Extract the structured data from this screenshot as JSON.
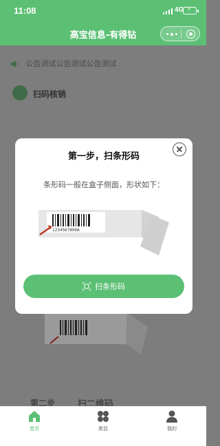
{
  "status_bar": {
    "time": "11:08",
    "network": "4G"
  },
  "nav": {
    "title": "高宝信息-有得钻"
  },
  "background": {
    "notice_text": "公告测试公告测试公告测试",
    "scan_title": "扫码核销",
    "step2_label": "第二步",
    "step2_text": "扫二维码"
  },
  "modal": {
    "title": "第一步，扫条形码",
    "description": "条形码一般在盒子侧面，形状如下：",
    "barcode_number": "1234567890A",
    "button_label": "扫条形码"
  },
  "tabbar": {
    "items": [
      {
        "label": "首页",
        "icon": "home-icon",
        "active": true
      },
      {
        "label": "类目",
        "icon": "category-icon",
        "active": false
      },
      {
        "label": "我的",
        "icon": "user-icon",
        "active": false
      }
    ]
  },
  "colors": {
    "brand": "#5bbf74",
    "overlay": "#7d7d7d",
    "text": "#111111"
  }
}
